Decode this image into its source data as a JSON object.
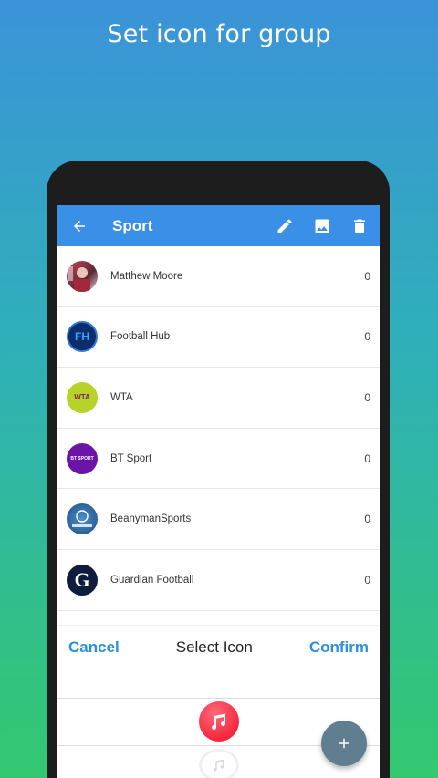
{
  "promo": {
    "title": "Set icon for group"
  },
  "appbar": {
    "title": "Sport",
    "icons": [
      "arrow-back-icon",
      "pencil-icon",
      "image-icon",
      "trash-icon"
    ]
  },
  "items": [
    {
      "name": "Matthew Moore",
      "count": "0",
      "avatar": "photo"
    },
    {
      "name": "Football Hub",
      "count": "0",
      "avatar": "FH"
    },
    {
      "name": "WTA",
      "count": "0",
      "avatar": "WTA"
    },
    {
      "name": "BT Sport",
      "count": "0",
      "avatar": "BT SPORT"
    },
    {
      "name": "BeanymanSports",
      "count": "0",
      "avatar": "crest"
    },
    {
      "name": "Guardian Football",
      "count": "0",
      "avatar": "G"
    }
  ],
  "dialog": {
    "cancel": "Cancel",
    "title": "Select Icon",
    "confirm": "Confirm"
  },
  "colors": {
    "appbar": "#3a8fe6",
    "accent": "#2d8fde",
    "fab": "#5f7f91",
    "music_icon": "#f5263e"
  }
}
